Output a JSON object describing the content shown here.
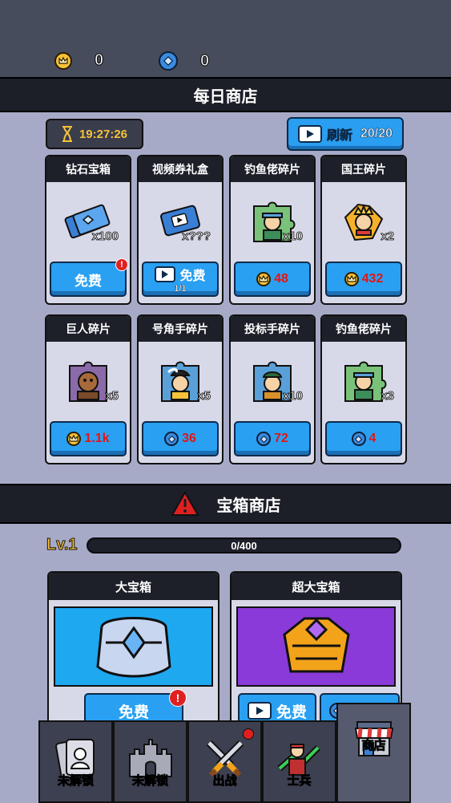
{
  "resources": {
    "crowns": "0",
    "gems": "0"
  },
  "daily_shop": {
    "title": "每日商店",
    "timer": "19:27:26",
    "refresh_label": "刷新",
    "refresh_count": "20/20",
    "items": [
      {
        "name": "钻石宝箱",
        "qty": "x100",
        "button": "免费",
        "price_type": "free",
        "badge": true
      },
      {
        "name": "视频券礼盒",
        "qty": "x???",
        "button": "免费",
        "price_type": "video",
        "sub": "1/1"
      },
      {
        "name": "钓鱼佬碎片",
        "qty": "x10",
        "price": "48",
        "price_type": "crown"
      },
      {
        "name": "国王碎片",
        "qty": "x2",
        "price": "432",
        "price_type": "crown"
      },
      {
        "name": "巨人碎片",
        "qty": "x5",
        "price": "1.1k",
        "price_type": "crown"
      },
      {
        "name": "号角手碎片",
        "qty": "x5",
        "price": "36",
        "price_type": "gem"
      },
      {
        "name": "投标手碎片",
        "qty": "x10",
        "price": "72",
        "price_type": "gem"
      },
      {
        "name": "钓鱼佬碎片",
        "qty": "x3",
        "price": "4",
        "price_type": "gem"
      }
    ]
  },
  "chest_shop": {
    "title": "宝箱商店",
    "level": "Lv.1",
    "progress_text": "0/400",
    "progress": 0,
    "chests": [
      {
        "name": "大宝箱",
        "button": "免费",
        "badge": true
      },
      {
        "name": "超大宝箱",
        "button": "免费"
      }
    ]
  },
  "nav": [
    {
      "label": "未解锁",
      "icon": "locked-card-icon"
    },
    {
      "label": "未解锁",
      "icon": "castle-icon"
    },
    {
      "label": "出战",
      "icon": "swords-icon",
      "dot": true
    },
    {
      "label": "士兵",
      "icon": "soldier-icon"
    },
    {
      "label": "商店",
      "icon": "shop-icon",
      "active": true
    }
  ],
  "colors": {
    "accent_blue": "#2aa0f2",
    "gold": "#f6c23a",
    "price_red": "#e01616",
    "header_dark": "#1c1e28"
  }
}
